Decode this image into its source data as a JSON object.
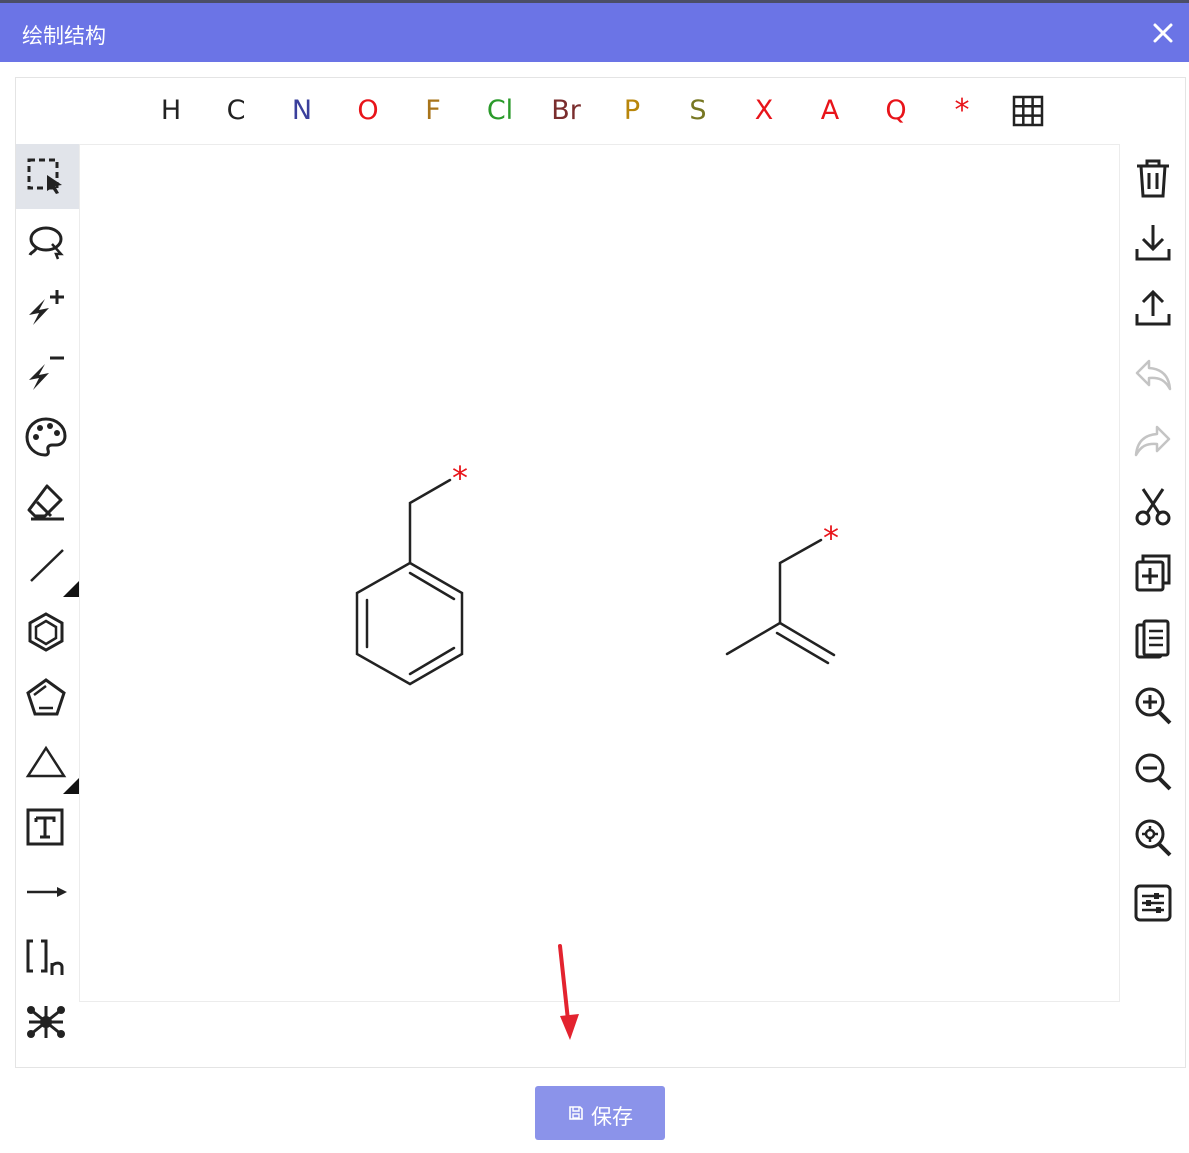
{
  "dialog": {
    "title": "绘制结构",
    "save_label": "保存"
  },
  "atoms": [
    {
      "symbol": "H",
      "color": "#222222"
    },
    {
      "symbol": "C",
      "color": "#222222"
    },
    {
      "symbol": "N",
      "color": "#3a3f9c"
    },
    {
      "symbol": "O",
      "color": "#e8141a"
    },
    {
      "symbol": "F",
      "color": "#a8741a"
    },
    {
      "symbol": "Cl",
      "color": "#2a9a2a"
    },
    {
      "symbol": "Br",
      "color": "#7a2d2d"
    },
    {
      "symbol": "P",
      "color": "#b8860b"
    },
    {
      "symbol": "S",
      "color": "#777722"
    },
    {
      "symbol": "X",
      "color": "#e8141a"
    },
    {
      "symbol": "A",
      "color": "#e8141a"
    },
    {
      "symbol": "Q",
      "color": "#e8141a"
    },
    {
      "symbol": "*",
      "color": "#e8141a"
    }
  ],
  "left_tools": [
    {
      "name": "select-rect-tool",
      "active": true
    },
    {
      "name": "lasso-tool"
    },
    {
      "name": "charge-plus-tool"
    },
    {
      "name": "charge-minus-tool"
    },
    {
      "name": "palette-tool"
    },
    {
      "name": "eraser-tool"
    },
    {
      "name": "bond-tool"
    },
    {
      "name": "benzene-tool"
    },
    {
      "name": "cyclopentadiene-tool"
    },
    {
      "name": "triangle-shape-tool"
    },
    {
      "name": "text-tool"
    },
    {
      "name": "reaction-arrow-tool"
    },
    {
      "name": "sgroup-bracket-tool",
      "label": "[]n"
    },
    {
      "name": "rgroup-tool"
    }
  ],
  "right_tools": [
    {
      "name": "clear-canvas",
      "enabled": true
    },
    {
      "name": "open-file",
      "enabled": true
    },
    {
      "name": "save-file",
      "enabled": true
    },
    {
      "name": "undo",
      "enabled": false
    },
    {
      "name": "redo",
      "enabled": false
    },
    {
      "name": "cut",
      "enabled": true
    },
    {
      "name": "copy",
      "enabled": true
    },
    {
      "name": "paste",
      "enabled": true
    },
    {
      "name": "zoom-in",
      "enabled": true
    },
    {
      "name": "zoom-out",
      "enabled": true
    },
    {
      "name": "zoom-fit",
      "enabled": true
    },
    {
      "name": "settings",
      "enabled": true
    }
  ],
  "canvas": {
    "molecules": [
      {
        "name": "benzyl-radical",
        "attachment": "*"
      },
      {
        "name": "methallyl-radical",
        "attachment": "*"
      }
    ]
  },
  "colors": {
    "header": "#6b74e6",
    "save_button": "#8b93ea",
    "annotation_arrow": "#e3232f",
    "attachment": "#e8141a"
  }
}
